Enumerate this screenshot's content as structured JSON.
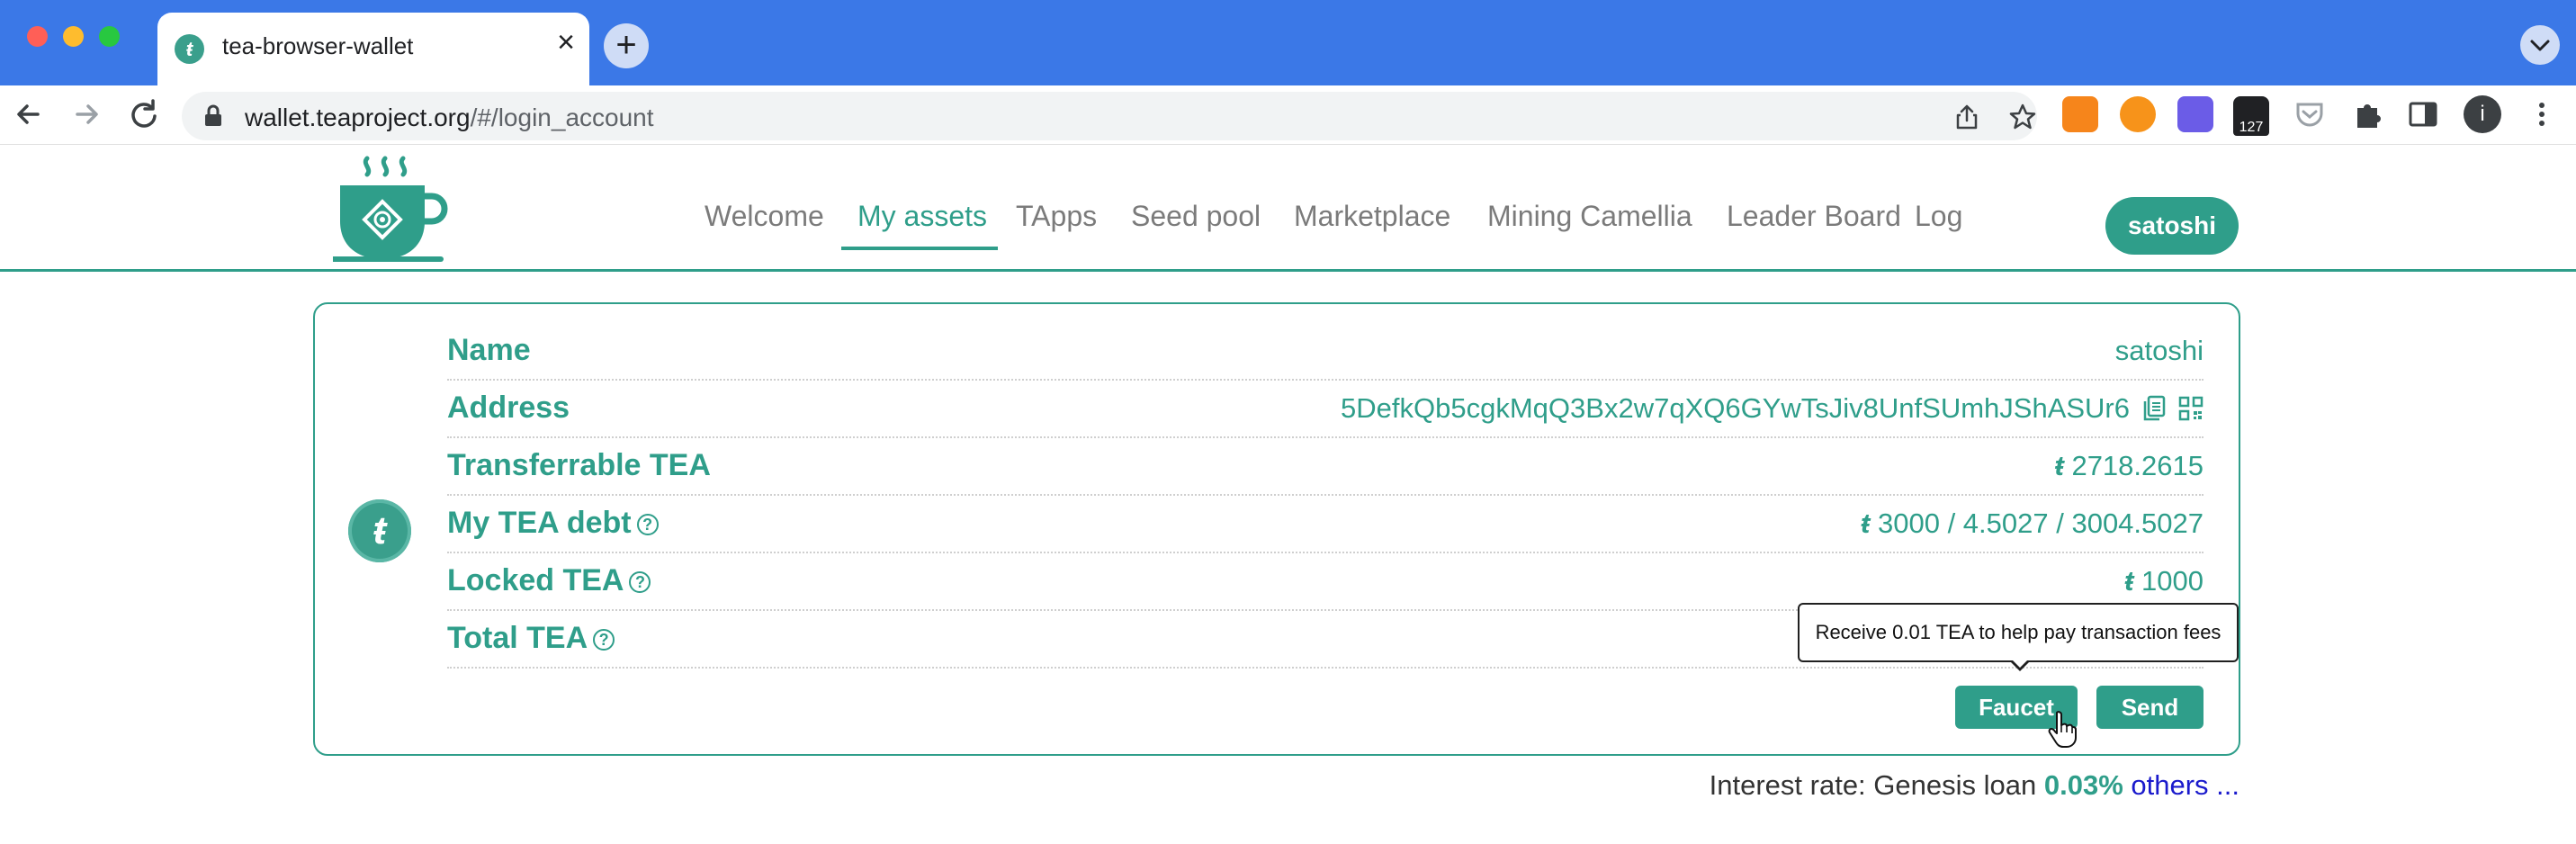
{
  "browser": {
    "tab_title": "tea-browser-wallet",
    "url_host": "wallet.teaproject.org",
    "url_path": "/#/login_account",
    "extension_badge": "127",
    "profile_initial": "i"
  },
  "site": {
    "nav": [
      "Welcome",
      "My assets",
      "TApps",
      "Seed pool",
      "Marketplace",
      "Mining Camellia",
      "Leader Board",
      "Log"
    ],
    "active_nav": "My assets",
    "user_button": "satoshi"
  },
  "account": {
    "name_label": "Name",
    "name_value": "satoshi",
    "address_label": "Address",
    "address_value": "5DefkQb5cgkMqQ3Bx2w7qXQ6GYwTsJiv8UnfSUmhJShASUr6",
    "transferrable_label": "Transferrable TEA",
    "transferrable_value": "2718.2615",
    "debt_label": "My TEA debt",
    "debt_value": "3000 / 4.5027 / 3004.5027",
    "locked_label": "Locked TEA",
    "locked_value": "1000",
    "total_label": "Total TEA",
    "tea_symbol": "ŧ",
    "help_glyph": "?"
  },
  "actions": {
    "faucet_label": "Faucet",
    "send_label": "Send",
    "faucet_tooltip": "Receive 0.01 TEA to help pay transaction fees"
  },
  "footer": {
    "interest_prefix": "Interest rate: Genesis loan",
    "interest_rate": "0.03%",
    "others_link": "others ..."
  },
  "colors": {
    "accent": "#2f9e8a",
    "browser_tabbar": "#3b78e7",
    "link": "#1a1acc"
  }
}
